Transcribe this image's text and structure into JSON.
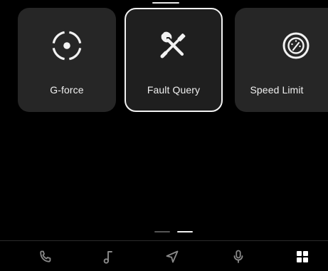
{
  "screen": {
    "tiles": [
      {
        "label": "G-force",
        "icon": "g-force-icon"
      },
      {
        "label": "Fault Query",
        "icon": "wrench-screwdriver-icon",
        "selected": true
      },
      {
        "label": "Speed Limit",
        "icon": "speed-limit-icon"
      }
    ],
    "pager": {
      "pages": 2,
      "current": 2
    }
  },
  "dock": {
    "items": [
      {
        "icon": "phone-icon"
      },
      {
        "icon": "music-note-icon"
      },
      {
        "icon": "navigation-arrow-icon"
      },
      {
        "icon": "microphone-icon"
      },
      {
        "icon": "app-grid-icon",
        "active": true
      }
    ]
  },
  "colors": {
    "background": "#000000",
    "tile": "#262626",
    "selected_border": "#f2f2f2",
    "text": "#f0f0f0",
    "dock_icon_inactive": "#8a8a8a",
    "dock_icon_active": "#ffffff"
  }
}
